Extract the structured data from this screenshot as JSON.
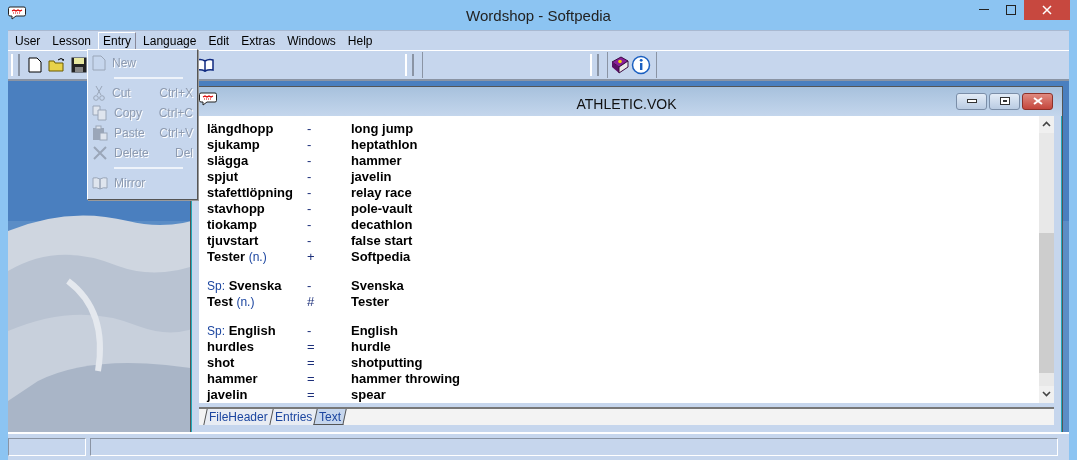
{
  "window": {
    "title": "Wordshop - Softpedia"
  },
  "menubar": [
    {
      "label": "User",
      "selected": false
    },
    {
      "label": "Lesson",
      "selected": false
    },
    {
      "label": "Entry",
      "selected": true
    },
    {
      "label": "Language",
      "selected": false
    },
    {
      "label": "Edit",
      "selected": false
    },
    {
      "label": "Extras",
      "selected": false
    },
    {
      "label": "Windows",
      "selected": false
    },
    {
      "label": "Help",
      "selected": false
    }
  ],
  "entry_menu": [
    {
      "kind": "item",
      "label": "New",
      "disabled": true
    },
    {
      "kind": "separator"
    },
    {
      "kind": "item",
      "label": "Cut",
      "shortcut": "Ctrl+X",
      "disabled": true
    },
    {
      "kind": "item",
      "label": "Copy",
      "shortcut": "Ctrl+C",
      "disabled": true
    },
    {
      "kind": "item",
      "label": "Paste",
      "shortcut": "Ctrl+V",
      "disabled": true
    },
    {
      "kind": "item",
      "label": "Delete",
      "shortcut": "Del",
      "disabled": true
    },
    {
      "kind": "separator"
    },
    {
      "kind": "item",
      "label": "Mirror",
      "disabled": true
    }
  ],
  "document": {
    "title": "ATHLETIC.VOK",
    "blocks": [
      {
        "lines": [
          {
            "kind": "entry",
            "term": "längdhopp",
            "sep": "-",
            "translation": "long jump"
          },
          {
            "kind": "entry",
            "term": "sjukamp",
            "sep": "-",
            "translation": "heptathlon"
          },
          {
            "kind": "entry",
            "term": "slägga",
            "sep": "-",
            "translation": "hammer"
          },
          {
            "kind": "entry",
            "term": "spjut",
            "sep": "-",
            "translation": "javelin"
          },
          {
            "kind": "entry",
            "term": "stafettlöpning",
            "sep": "-",
            "translation": "relay race"
          },
          {
            "kind": "entry",
            "term": "stavhopp",
            "sep": "-",
            "translation": "pole-vault"
          },
          {
            "kind": "entry",
            "term": "tiokamp",
            "sep": "-",
            "translation": "decathlon"
          },
          {
            "kind": "entry",
            "term": "tjuvstart",
            "sep": "-",
            "translation": "false start"
          },
          {
            "kind": "entry",
            "term": "Tester",
            "note": "(n.)",
            "sep": "+",
            "translation": "Softpedia"
          }
        ]
      },
      {
        "lines": [
          {
            "kind": "language",
            "prefix": "Sp:",
            "term": "Svenska",
            "sep": "-",
            "translation": "Svenska"
          },
          {
            "kind": "entry",
            "term": "Test",
            "note": "(n.)",
            "sep": "#",
            "translation": "Tester"
          }
        ]
      },
      {
        "lines": [
          {
            "kind": "language",
            "prefix": "Sp:",
            "term": "English",
            "sep": "-",
            "translation": "English"
          },
          {
            "kind": "entry",
            "term": "hurdles",
            "sep": "=",
            "translation": "hurdle"
          },
          {
            "kind": "entry",
            "term": "shot",
            "sep": "=",
            "translation": "shotputting"
          },
          {
            "kind": "entry",
            "term": "hammer",
            "sep": "=",
            "translation": "hammer throwing"
          },
          {
            "kind": "entry",
            "term": "javelin",
            "sep": "=",
            "translation": "spear"
          }
        ]
      }
    ],
    "tabs": [
      {
        "label": "FileHeader",
        "selected": false
      },
      {
        "label": "Entries",
        "selected": false
      },
      {
        "label": "Text",
        "selected": true
      }
    ]
  }
}
